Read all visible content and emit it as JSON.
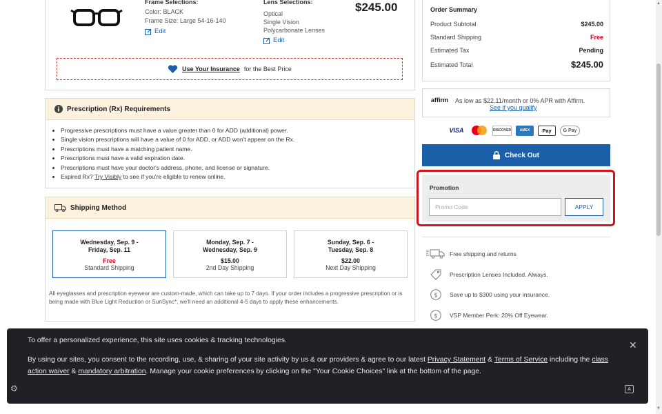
{
  "product": {
    "frame_title": "Frame Selections:",
    "frame_color": "Color: BLACK",
    "frame_size": "Frame Size: Large 54-16-140",
    "lens_title": "Lens Selections:",
    "lens_lines": [
      "Optical",
      "Single Vision",
      "Polycarbonate Lenses"
    ],
    "edit_label": "Edit",
    "price": "$245.00",
    "insurance_link": "Use Your Insurance",
    "insurance_suffix": "for the Best Price"
  },
  "rx": {
    "title": "Prescription (Rx) Requirements",
    "items": [
      "Progressive prescriptions must have a value greater than 0 for ADD (additional) power.",
      "Single vision prescriptions will have a value of 0 for ADD, or ADD won't appear on the Rx.",
      "Prescriptions must have a matching patient name.",
      "Prescriptions must have a valid expiration date.",
      "Prescriptions must have your doctor's address, phone, and license or signature."
    ],
    "expired_prefix": "Expired Rx?",
    "expired_link": "Try Visibly",
    "expired_suffix": "to see if you're eligible to renew online."
  },
  "shipping": {
    "title": "Shipping Method",
    "options": [
      {
        "date1": "Wednesday, Sep. 9 -",
        "date2": "Friday, Sep. 11",
        "price": "Free",
        "type": "Standard Shipping"
      },
      {
        "date1": "Monday, Sep. 7 -",
        "date2": "Wednesday, Sep. 9",
        "price": "$15.00",
        "type": "2nd Day Shipping"
      },
      {
        "date1": "Sunday, Sep. 6 -",
        "date2": "Tuesday, Sep. 8",
        "price": "$22.00",
        "type": "Next Day Shipping"
      }
    ],
    "note": "All eyeglasses and prescription eyewear are custom-made, which can take up to 7 days. If your order includes a progressive prescription or is being made with Blue Light Reduction or SunSync*, we'll need an additional 4-5 days to apply these enhancements."
  },
  "summary": {
    "title": "Order Summary",
    "rows": [
      {
        "label": "Product Subtotal",
        "value": "$245.00"
      },
      {
        "label": "Standard Shipping",
        "value": "Free"
      },
      {
        "label": "Estimated Tax",
        "value": "Pending"
      },
      {
        "label": "Estimated Total",
        "value": "$245.00"
      }
    ]
  },
  "affirm": {
    "logo": "affirm",
    "text": "As low as $22.11/month or 0% APR with Affirm.",
    "link": "See if you qualify"
  },
  "payments": [
    "VISA",
    "DISCOVER",
    "AMEX",
    "Pay",
    "G Pay"
  ],
  "checkout": {
    "label": "Check Out"
  },
  "promo": {
    "label": "Promotion",
    "placeholder": "Promo Code",
    "apply": "APPLY"
  },
  "perks": [
    "Free shipping and returns",
    "Prescription Lenses Included. Always.",
    "Save up to $300 using your insurance.",
    "VSP Member Perk: 20% Off Eyewear."
  ],
  "cookie": {
    "line1": "To offer a personalized experience, this site uses cookies & tracking technologies.",
    "p1": "By using our sites, you consent to the recording, use, & sharing of your site activity by us & our providers & agree to our latest",
    "privacy": "Privacy Statement",
    "amp1": "&",
    "terms": "Terms of Service",
    "including": "including the",
    "class_action": "class action waiver",
    "amp2": "&",
    "arbitration": "mandatory arbitration",
    "p2": ". Manage your cookie preferences by clicking on the \"Your Cookie Choices\" link at the bottom of the page."
  },
  "colors": {
    "accent": "#1a5fa8",
    "alert": "#d0161d",
    "free": "#d0021b",
    "banner": "#1f2124"
  }
}
